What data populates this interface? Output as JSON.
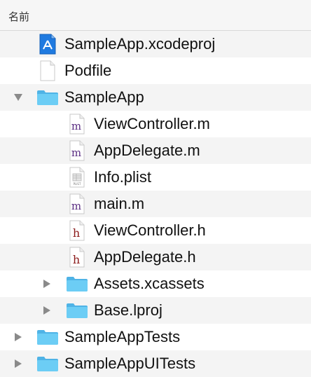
{
  "header": {
    "column_label": "名前"
  },
  "items": [
    {
      "label": "SampleApp.xcodeproj",
      "icon": "xcodeproj-icon"
    },
    {
      "label": "Podfile",
      "icon": "document-icon"
    },
    {
      "label": "SampleApp",
      "icon": "folder-icon",
      "expanded": true
    },
    {
      "label": "ViewController.m",
      "icon": "objc-m-file-icon",
      "glyph": "m"
    },
    {
      "label": "AppDelegate.m",
      "icon": "objc-m-file-icon",
      "glyph": "m"
    },
    {
      "label": "Info.plist",
      "icon": "plist-file-icon",
      "glyph": "PLIST"
    },
    {
      "label": "main.m",
      "icon": "objc-m-file-icon",
      "glyph": "m"
    },
    {
      "label": "ViewController.h",
      "icon": "header-h-file-icon",
      "glyph": "h"
    },
    {
      "label": "AppDelegate.h",
      "icon": "header-h-file-icon",
      "glyph": "h"
    },
    {
      "label": "Assets.xcassets",
      "icon": "folder-icon",
      "expanded": false
    },
    {
      "label": "Base.lproj",
      "icon": "folder-icon",
      "expanded": false
    },
    {
      "label": "SampleAppTests",
      "icon": "folder-icon",
      "expanded": false
    },
    {
      "label": "SampleAppUITests",
      "icon": "folder-icon",
      "expanded": false
    }
  ],
  "colors": {
    "folder": "#5ec3f2",
    "folder_tab": "#4fb3e6",
    "m_glyph": "#5a2d82",
    "h_glyph": "#8b1a1a",
    "disclosure": "#8a8a8a",
    "stripe": "#f4f4f4"
  }
}
